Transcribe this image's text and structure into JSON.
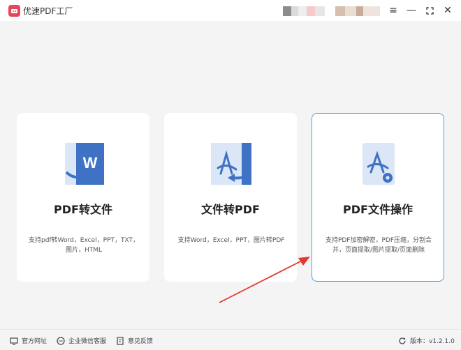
{
  "app": {
    "title": "优速PDF工厂"
  },
  "window_controls": {
    "menu": "≡",
    "minimize": "—",
    "maximize": "⛶",
    "close": "✕"
  },
  "cards": [
    {
      "title": "PDF转文件",
      "desc": "支持pdf转Word，Excel，PPT，TXT，图片，HTML",
      "icon": "pdf-to-word-icon"
    },
    {
      "title": "文件转PDF",
      "desc": "支持Word，Excel，PPT，图片转PDF",
      "icon": "file-to-pdf-icon"
    },
    {
      "title": "PDF文件操作",
      "desc": "支持PDF加密解密，PDF压缩，分割合并，页面提取/图片提取/页面删除",
      "icon": "pdf-operations-icon"
    }
  ],
  "footer": {
    "website": "官方网址",
    "support": "企业微信客服",
    "feedback": "意见反馈",
    "version": "版本：v1.2.1.0"
  },
  "colors": {
    "accent": "#3f72c4",
    "active_border": "#4aa3d8",
    "brand": "#e8455a",
    "annotation": "#e23b2e"
  }
}
